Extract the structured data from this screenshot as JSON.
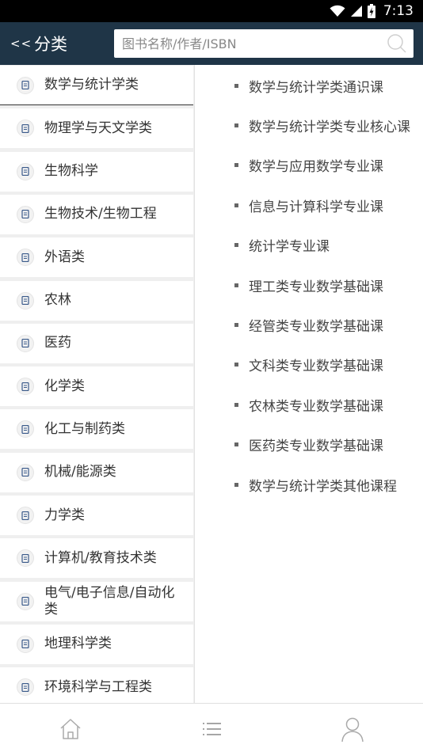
{
  "status_bar": {
    "time": "7:13"
  },
  "header": {
    "back_label": "<<",
    "title": "分类",
    "search_placeholder": "图书名称/作者/ISBN"
  },
  "categories": [
    {
      "label": "数学与统计学类",
      "selected": true
    },
    {
      "label": "物理学与天文学类"
    },
    {
      "label": "生物科学"
    },
    {
      "label": "生物技术/生物工程"
    },
    {
      "label": "外语类"
    },
    {
      "label": "农林"
    },
    {
      "label": "医药"
    },
    {
      "label": "化学类"
    },
    {
      "label": "化工与制药类"
    },
    {
      "label": "机械/能源类"
    },
    {
      "label": "力学类"
    },
    {
      "label": "计算机/教育技术类"
    },
    {
      "label": "电气/电子信息/自动化类"
    },
    {
      "label": "地理科学类"
    },
    {
      "label": "环境科学与工程类"
    }
  ],
  "subcategories": [
    "数学与统计学类通识课",
    "数学与统计学类专业核心课",
    "数学与应用数学专业课",
    "信息与计算科学专业课",
    "统计学专业课",
    "理工类专业数学基础课",
    "经管类专业数学基础课",
    "文科类专业数学基础课",
    "农林类专业数学基础课",
    "医药类专业数学基础课",
    "数学与统计学类其他课程"
  ],
  "bottom_nav": {
    "items": [
      {
        "icon": "home-icon"
      },
      {
        "icon": "list-icon"
      },
      {
        "icon": "user-icon"
      }
    ]
  },
  "colors": {
    "header_bg": "#1f3547",
    "status_bg": "#000000"
  }
}
